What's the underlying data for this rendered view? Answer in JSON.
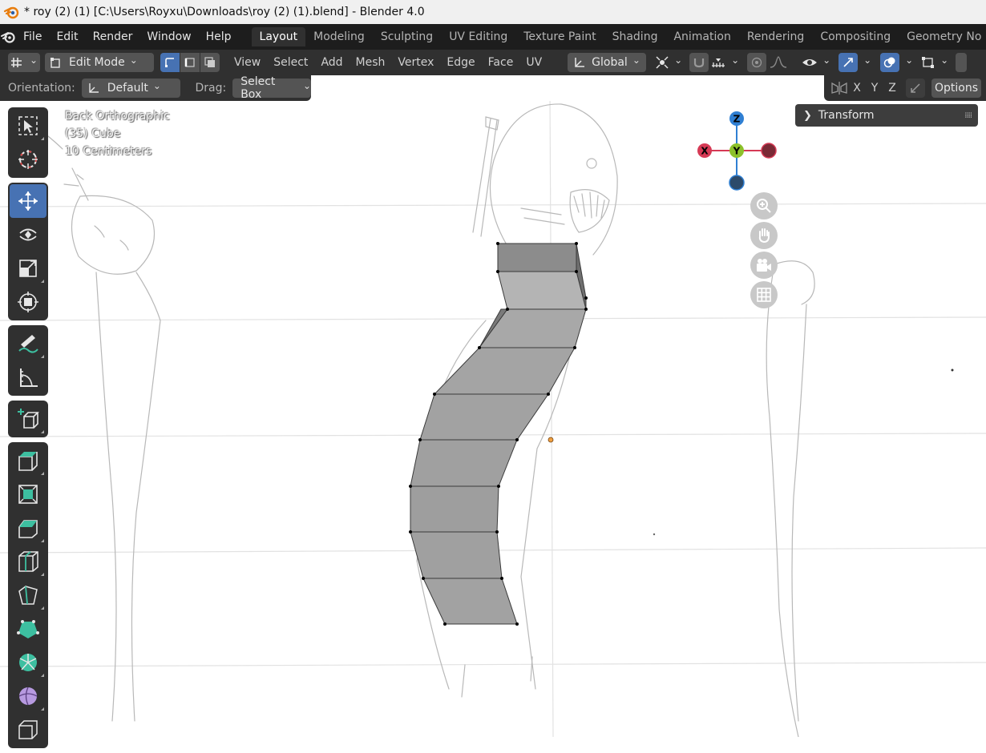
{
  "window": {
    "title": "* roy (2) (1) [C:\\Users\\Royxu\\Downloads\\roy (2) (1).blend] - Blender 4.0"
  },
  "menu": [
    "File",
    "Edit",
    "Render",
    "Window",
    "Help"
  ],
  "workspaces": {
    "tabs": [
      "Layout",
      "Modeling",
      "Sculpting",
      "UV Editing",
      "Texture Paint",
      "Shading",
      "Animation",
      "Rendering",
      "Compositing",
      "Geometry No"
    ],
    "active": "Layout"
  },
  "header": {
    "mode": "Edit Mode",
    "menus": [
      "View",
      "Select",
      "Add",
      "Mesh",
      "Vertex",
      "Edge",
      "Face",
      "UV"
    ],
    "transform_orientation": "Global"
  },
  "tool_settings": {
    "orientation_label": "Orientation:",
    "orientation_value": "Default",
    "drag_label": "Drag:",
    "drag_value": "Select Box",
    "axes": [
      "X",
      "Y",
      "Z"
    ],
    "options_label": "Options"
  },
  "viewport": {
    "view_name": "Back Orthographic",
    "object_info": "(35) Cube",
    "scale_info": "10 Centimeters",
    "transform_panel_label": "Transform",
    "gizmo": {
      "z": "Z",
      "x": "X",
      "y": "Y"
    }
  },
  "colors": {
    "accent": "#4772b3",
    "gizmo_x": "#d63a55",
    "gizmo_y": "#8cc12b",
    "gizmo_z": "#2f7fd3"
  }
}
